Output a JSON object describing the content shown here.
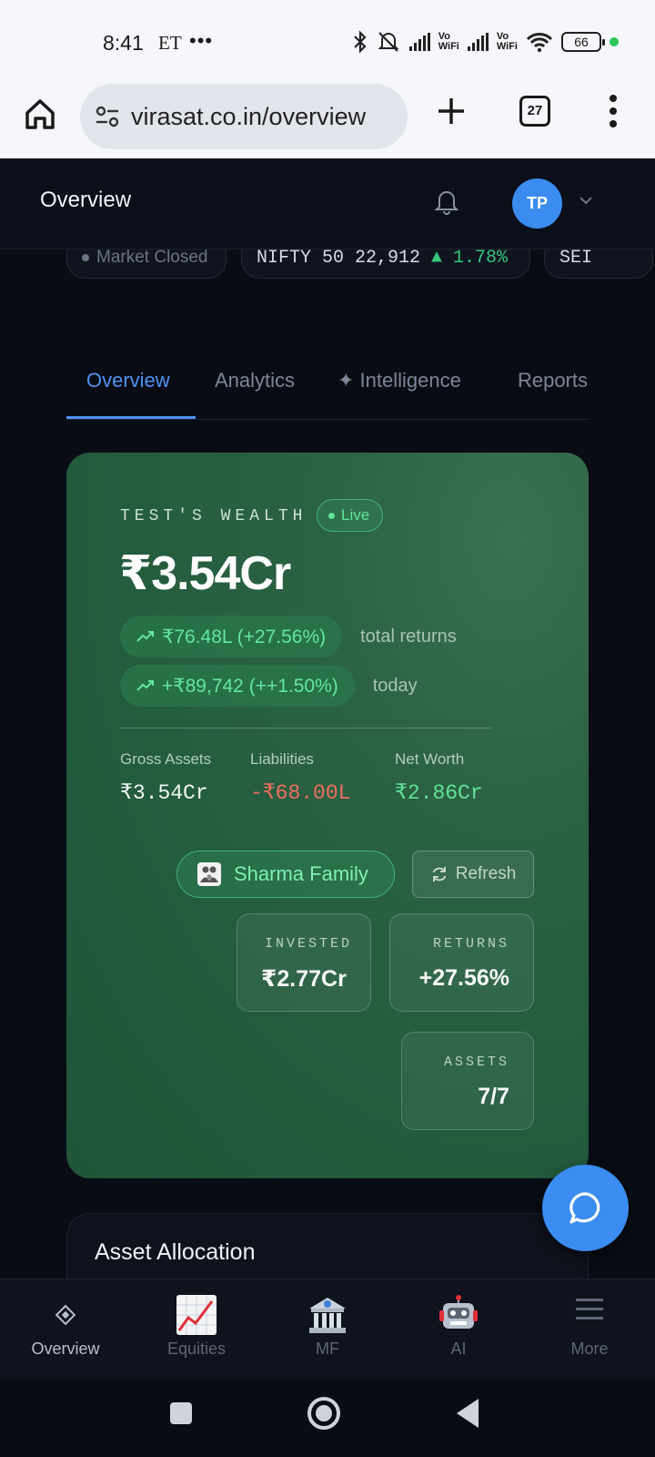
{
  "status_bar": {
    "time": "8:41",
    "carrier": "ET",
    "more": "•••",
    "vo_wifi": "Vo WiFi",
    "battery": "66"
  },
  "browser": {
    "url": "virasat.co.in/overview",
    "tab_count": "27"
  },
  "app_header": {
    "title": "Overview",
    "avatar_initials": "TP"
  },
  "ticker": {
    "market_status": "Market Closed",
    "nifty": "NIFTY 50  22,912",
    "nifty_change": "▲ 1.78%",
    "sensex_partial": "SEI"
  },
  "tabs": [
    {
      "label": "Overview",
      "active": true
    },
    {
      "label": "Analytics",
      "active": false
    },
    {
      "label": "✦ Intelligence",
      "active": false
    },
    {
      "label": "Reports",
      "active": false
    }
  ],
  "wealth": {
    "label": "TEST'S WEALTH",
    "live": "Live",
    "total": "₹3.54Cr",
    "total_returns": "₹76.48L (+27.56%)",
    "total_returns_note": "total returns",
    "today_returns": "+₹89,742 (++1.50%)",
    "today_note": "today",
    "gross_assets_label": "Gross Assets",
    "gross_assets": "₹3.54Cr",
    "liabilities_label": "Liabilities",
    "liabilities": "-₹68.00L",
    "net_worth_label": "Net Worth",
    "net_worth": "₹2.86Cr",
    "family_button": "Sharma Family",
    "refresh_button": "Refresh",
    "invested_label": "INVESTED",
    "invested": "₹2.77Cr",
    "returns_label": "RETURNS",
    "returns": "+27.56%",
    "assets_label": "ASSETS",
    "assets": "7/7"
  },
  "asset_allocation": {
    "title": "Asset Allocation"
  },
  "bottom_nav": [
    {
      "label": "Overview",
      "icon": "diamond-icon"
    },
    {
      "label": "Equities",
      "icon": "chart-increasing-icon"
    },
    {
      "label": "MF",
      "icon": "bank-icon"
    },
    {
      "label": "AI",
      "icon": "robot-icon"
    },
    {
      "label": "More",
      "icon": "hamburger-icon"
    }
  ],
  "colors": {
    "accent_blue": "#3b8cf0",
    "card_green": "#2c6244",
    "positive": "#5ee596",
    "negative": "#f06e5e"
  }
}
